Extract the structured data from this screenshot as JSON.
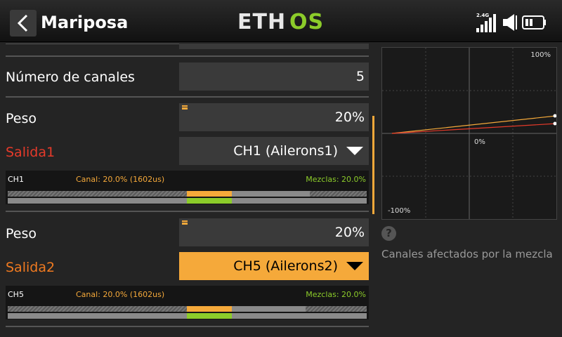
{
  "header": {
    "title": "Mariposa",
    "logo": "ETHOS",
    "radio_band": "2.4G"
  },
  "rows": {
    "channels": {
      "label": "Número de canales",
      "value": "5"
    },
    "weight1": {
      "label": "Peso",
      "value": "20%"
    },
    "output1": {
      "label": "Salida1",
      "value": "CH1 (Ailerons1)"
    },
    "weight2": {
      "label": "Peso",
      "value": "20%"
    },
    "output2": {
      "label": "Salida2",
      "value": "CH5 (Ailerons2)"
    }
  },
  "monitors": [
    {
      "channel": "CH1",
      "canal": "Canal: 20.0% (1602us)",
      "mezclas": "Mezclas: 20.0%",
      "canal_level": 0.2,
      "mix_level": 0.2
    },
    {
      "channel": "CH5",
      "canal": "Canal: 20.0% (1602us)",
      "mezclas": "Mezclas: 20.0%",
      "canal_level": 0.2,
      "mix_level": 0.2
    }
  ],
  "graph": {
    "top_label": "100%",
    "center_label": "0%",
    "bottom_label": "-100%"
  },
  "help": {
    "icon": "?",
    "text": "Canales afectados por la mezcla"
  },
  "colors": {
    "accent": "#f5a93a",
    "output1": "#e53a2a",
    "output2": "#f07a20",
    "mix_green": "#8ccc2a",
    "logo_green": "#8ccc2a"
  }
}
